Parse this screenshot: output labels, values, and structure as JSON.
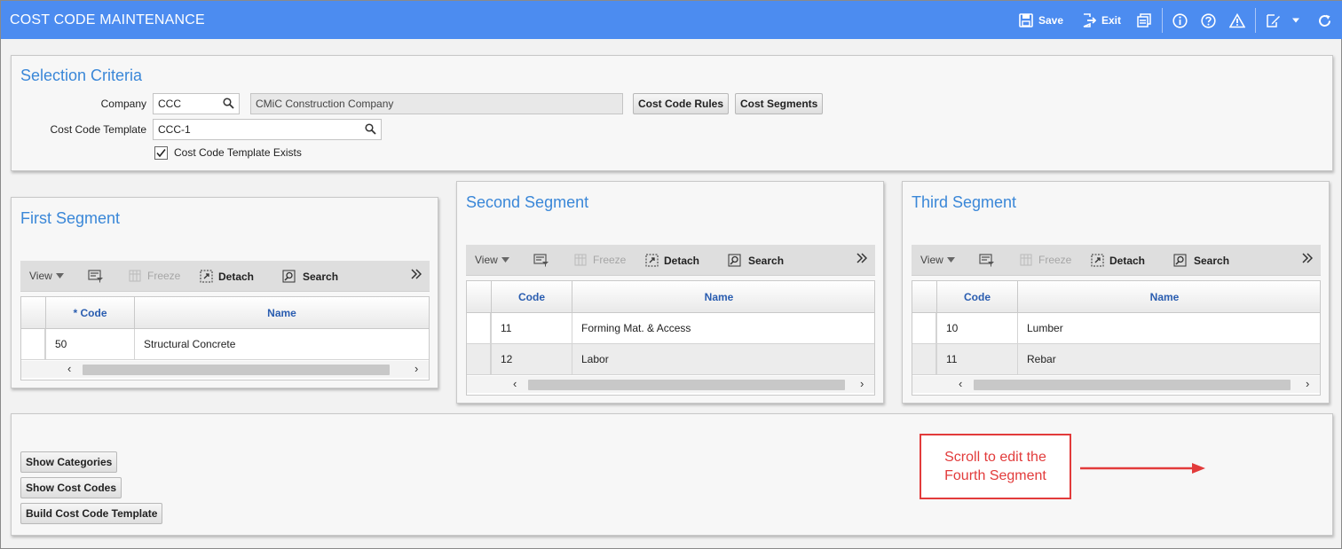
{
  "app": {
    "title": "COST CODE MAINTENANCE",
    "toolbar": {
      "save_label": "Save",
      "exit_label": "Exit",
      "accent_color": "#4c8cf0"
    }
  },
  "selection": {
    "title": "Selection Criteria",
    "company_label": "Company",
    "company_value": "CCC",
    "company_name": "CMiC Construction Company",
    "cost_code_rules_label": "Cost Code Rules",
    "cost_segments_label": "Cost Segments",
    "template_label": "Cost Code Template",
    "template_value": "CCC-1",
    "template_exists_label": "Cost Code Template Exists",
    "template_exists_checked": true
  },
  "grid_toolbar": {
    "view": "View",
    "freeze": "Freeze",
    "detach": "Detach",
    "search": "Search"
  },
  "segments": [
    {
      "title": "First Segment",
      "columns": [
        "* Code",
        "Name"
      ],
      "rows": [
        {
          "code": "50",
          "name": "Structural Concrete"
        }
      ]
    },
    {
      "title": "Second Segment",
      "columns": [
        "Code",
        "Name"
      ],
      "rows": [
        {
          "code": "11",
          "name": "Forming Mat. & Access"
        },
        {
          "code": "12",
          "name": "Labor"
        }
      ]
    },
    {
      "title": "Third Segment",
      "columns": [
        "Code",
        "Name"
      ],
      "rows": [
        {
          "code": "10",
          "name": "Lumber"
        },
        {
          "code": "11",
          "name": "Rebar"
        }
      ]
    }
  ],
  "actions": {
    "show_categories": "Show Categories",
    "show_cost_codes": "Show Cost Codes",
    "build_template": "Build Cost Code Template"
  },
  "callout": {
    "line1": "Scroll to edit the",
    "line2": "Fourth Segment",
    "color": "#e23b3b"
  }
}
